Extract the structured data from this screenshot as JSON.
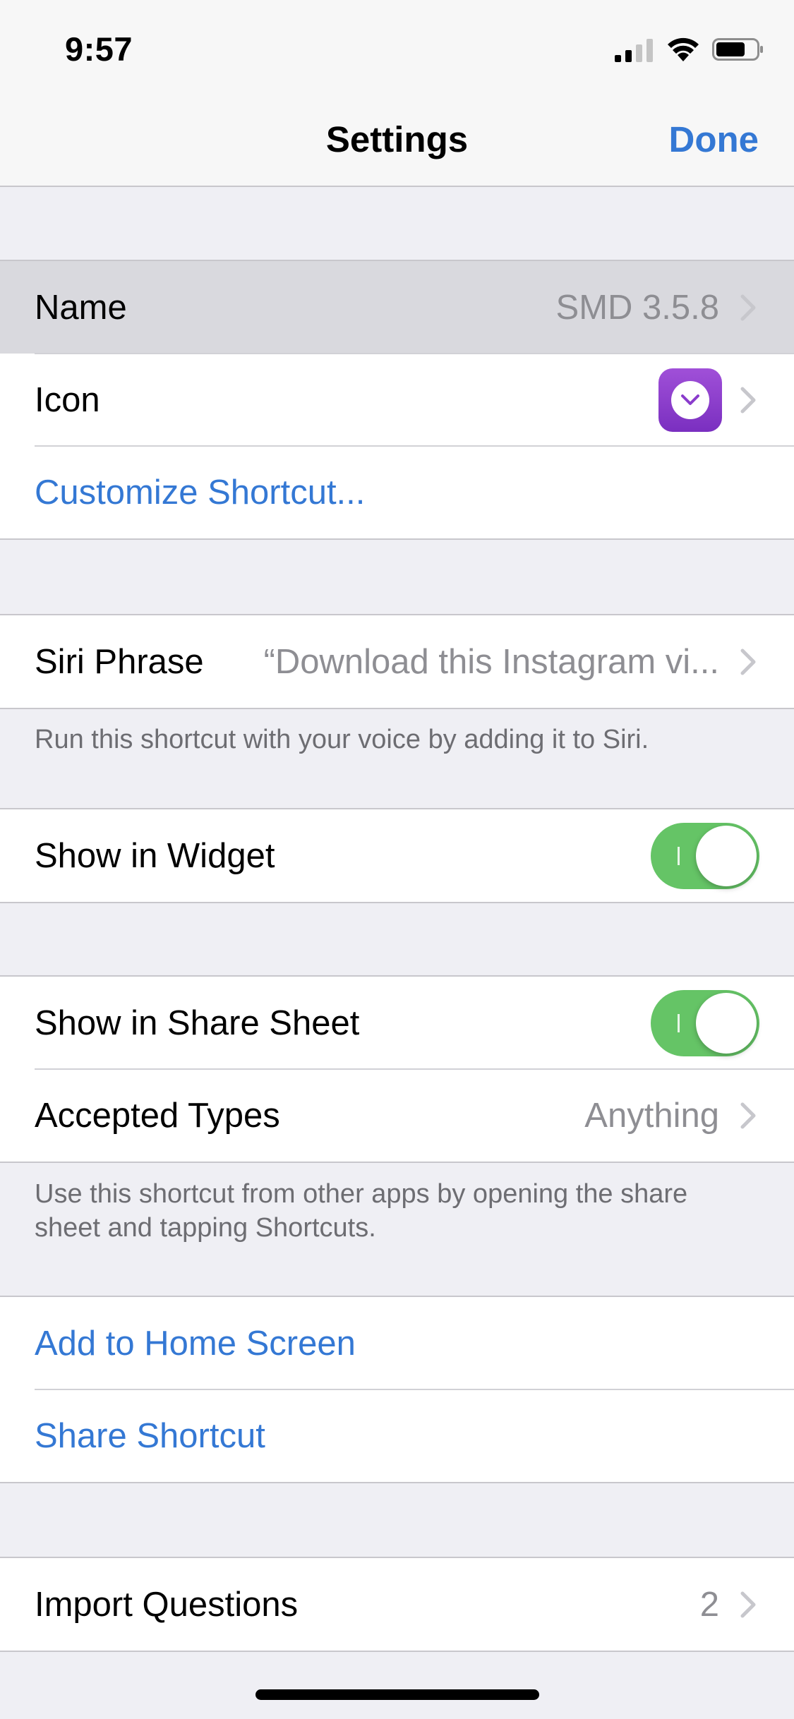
{
  "status_bar": {
    "time": "9:57"
  },
  "nav": {
    "title": "Settings",
    "done_label": "Done"
  },
  "colors": {
    "accent_blue": "#3478d4",
    "toggle_on": "#65c466",
    "icon_purple": "#8a3ccc"
  },
  "section_general": {
    "name_label": "Name",
    "name_value": "SMD 3.5.8",
    "icon_label": "Icon",
    "icon_glyph": "chevron-down-circle-icon",
    "customize_label": "Customize Shortcut..."
  },
  "section_siri": {
    "phrase_label": "Siri Phrase",
    "phrase_value": "“Download this Instagram vi...",
    "footnote": "Run this shortcut with your voice by adding it to Siri."
  },
  "section_widget": {
    "widget_label": "Show in Widget",
    "widget_on": true
  },
  "section_share": {
    "share_sheet_label": "Show in Share Sheet",
    "share_sheet_on": true,
    "accepted_types_label": "Accepted Types",
    "accepted_types_value": "Anything",
    "footnote": "Use this shortcut from other apps by opening the share sheet and tapping Shortcuts."
  },
  "section_actions": {
    "add_home_label": "Add to Home Screen",
    "share_shortcut_label": "Share Shortcut"
  },
  "section_import": {
    "import_label": "Import Questions",
    "import_value": "2"
  }
}
